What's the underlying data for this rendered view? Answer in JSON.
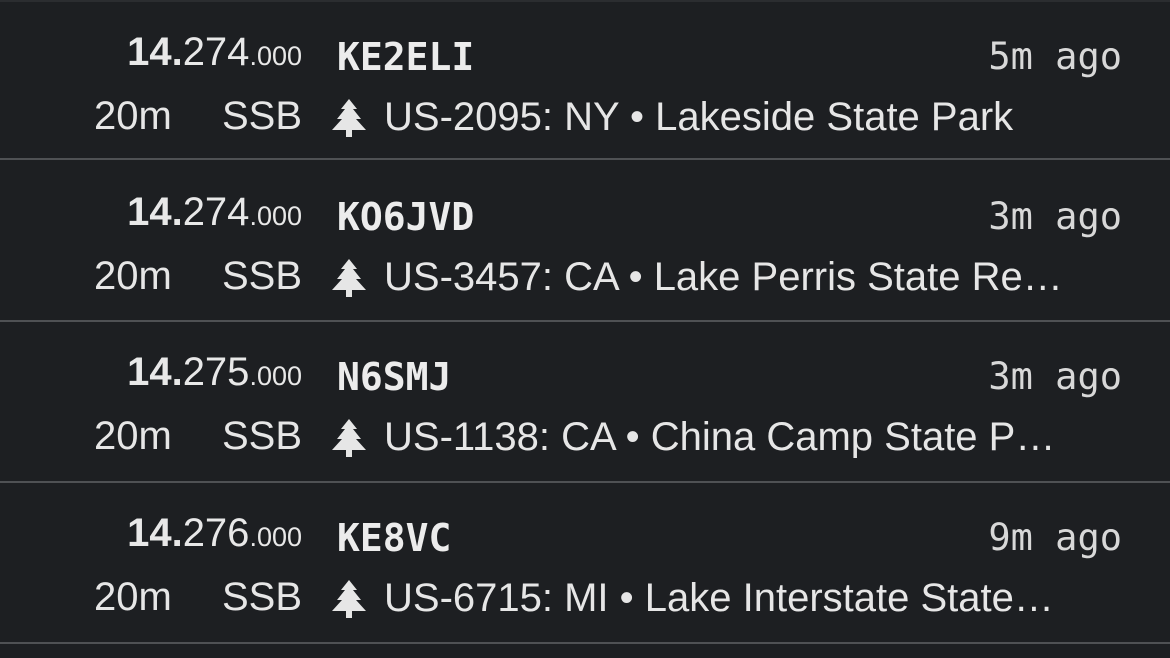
{
  "spots": [
    {
      "freq_mhz": "14.",
      "freq_khz": "274",
      "freq_hz": ".000",
      "callsign": "KE2ELI",
      "age": "5m ago",
      "band": "20m",
      "mode": "SSB",
      "icon": "tree-icon",
      "park": "US-2095: NY • Lakeside State Park"
    },
    {
      "freq_mhz": "14.",
      "freq_khz": "274",
      "freq_hz": ".000",
      "callsign": "KO6JVD",
      "age": "3m ago",
      "band": "20m",
      "mode": "SSB",
      "icon": "tree-icon",
      "park": "US-3457: CA • Lake Perris State Re…"
    },
    {
      "freq_mhz": "14.",
      "freq_khz": "275",
      "freq_hz": ".000",
      "callsign": "N6SMJ",
      "age": "3m ago",
      "band": "20m",
      "mode": "SSB",
      "icon": "tree-icon",
      "park": "US-1138: CA • China Camp State P…"
    },
    {
      "freq_mhz": "14.",
      "freq_khz": "276",
      "freq_hz": ".000",
      "callsign": "KE8VC",
      "age": "9m ago",
      "band": "20m",
      "mode": "SSB",
      "icon": "tree-icon",
      "park": "US-6715: MI • Lake Interstate State…"
    }
  ],
  "colors": {
    "background": "#1d1f22",
    "divider": "#4f5154",
    "text": "#e6e6e6"
  }
}
